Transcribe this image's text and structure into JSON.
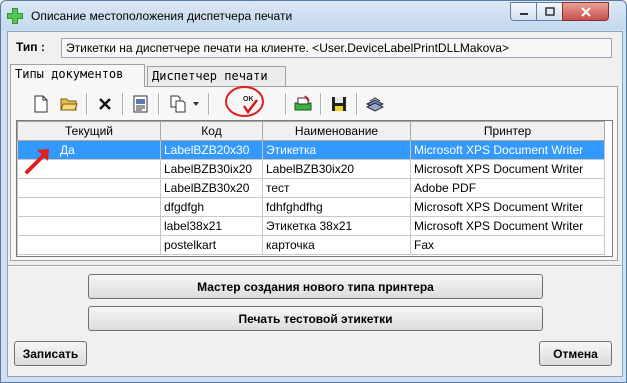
{
  "window": {
    "title": "Описание местоположения диспетчера печати"
  },
  "type_field": {
    "label": "Тип :",
    "value": "Этикетки на диспетчере печати на клиенте. <User.DeviceLabelPrintDLLMakova>"
  },
  "tabs": [
    {
      "label": "Типы документов",
      "active": true
    },
    {
      "label": "Диспетчер печати",
      "active": false
    }
  ],
  "toolbar": {
    "icons": [
      "new-document-icon",
      "open-folder-icon",
      "delete-icon",
      "properties-icon",
      "copy-document-icon",
      "dropdown-arrow-icon",
      "ok-check-icon",
      "print-test-icon",
      "save-icon",
      "printer-stack-icon"
    ],
    "ok_glyph": "OK"
  },
  "grid": {
    "columns": [
      "Текущий",
      "Код",
      "Наименование",
      "Принтер"
    ],
    "rows": [
      {
        "current": "Да",
        "code": "LabelBZB20x30",
        "name": "Этикетка",
        "printer": "Microsoft XPS Document Writer",
        "selected": true
      },
      {
        "current": "",
        "code": "LabelBZB30ix20",
        "name": "LabelBZB30ix20",
        "printer": "Microsoft XPS Document Writer",
        "selected": false
      },
      {
        "current": "",
        "code": "LabelBZB30x20",
        "name": "тест",
        "printer": "Adobe PDF",
        "selected": false
      },
      {
        "current": "",
        "code": "dfgdfgh",
        "name": "fdhfghdfhg",
        "printer": "Microsoft XPS Document Writer",
        "selected": false
      },
      {
        "current": "",
        "code": "label38x21",
        "name": "Этикетка 38x21",
        "printer": "Microsoft XPS Document Writer",
        "selected": false
      },
      {
        "current": "",
        "code": "postelkart",
        "name": "карточка",
        "printer": "Fax",
        "selected": false
      }
    ]
  },
  "buttons": {
    "wizard": "Мастер создания нового типа принтера",
    "print_test": "Печать тестовой этикетки",
    "save": "Записать",
    "cancel": "Отмена"
  },
  "colors": {
    "selection": "#3399ff",
    "annotation": "#e02020"
  }
}
